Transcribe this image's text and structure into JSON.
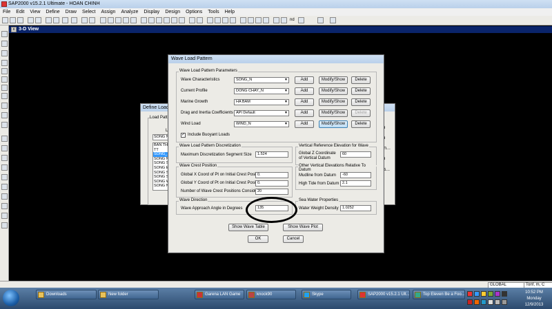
{
  "window": {
    "title": "SAP2000 v15.2.1 Ultimate - HOAN CHINH"
  },
  "menu": [
    "File",
    "Edit",
    "View",
    "Define",
    "Draw",
    "Select",
    "Assign",
    "Analyze",
    "Display",
    "Design",
    "Options",
    "Tools",
    "Help"
  ],
  "toolbar": {
    "nd_label": "nd"
  },
  "view": {
    "tab_label": "3-D View"
  },
  "back_dialog": {
    "title": "Define Load",
    "group_label": "Load Patte",
    "list_label": "Lo",
    "input_value": "SONG N",
    "list_items": [
      "BAN THA",
      "TT",
      "SONG_1",
      "SONG N",
      "SONG S",
      "SONG E",
      "SONG S",
      "SONG S",
      "SONG W",
      "SONG N"
    ],
    "right_buttons": [
      "ern",
      "ern",
      "tern...",
      "ern",
      "ttes..."
    ]
  },
  "dialog": {
    "title": "Wave Load Pattern",
    "params": {
      "legend": "Wave Load Pattern Parameters",
      "rows": [
        {
          "label": "Wave Characteristics",
          "value": "SONG_N",
          "add": "Add",
          "modify": "Modify/Show",
          "delete": "Delete"
        },
        {
          "label": "Current Profile",
          "value": "DONG CHAY_N",
          "add": "Add",
          "modify": "Modify/Show",
          "delete": "Delete"
        },
        {
          "label": "Marine Growth",
          "value": "HA BAM",
          "add": "Add",
          "modify": "Modify/Show",
          "delete": "Delete"
        },
        {
          "label": "Drag and Inertia Coefficients",
          "value": "API Default",
          "add": "Add",
          "modify": "Modify/Show",
          "delete": "Delete"
        },
        {
          "label": "Wind Load",
          "value": "WIND_N",
          "add": "Add",
          "modify": "Modify/Show",
          "delete": "Delete"
        }
      ],
      "buoyant_label": "Include Buoyant Loads"
    },
    "discretization": {
      "legend": "Wave Load Pattern Discretization",
      "label": "Maximum Discretization Segment Size",
      "value": "1.524"
    },
    "vertical_ref": {
      "legend": "Vertical Reference Elevation for Wave",
      "label_line1": "Global Z Coordinate",
      "label_line2": "of Vertical Datum",
      "value": "60"
    },
    "crest": {
      "legend": "Wave Crest Position",
      "rows": [
        {
          "label": "Global X Coord of Pt on Initial Crest Position",
          "value": "0."
        },
        {
          "label": "Global Y Coord of Pt on Initial Crest Position",
          "value": "0."
        },
        {
          "label": "Number of Wave Crest Positions Considered",
          "value": "20"
        }
      ]
    },
    "other_vertical": {
      "legend": "Other Vertical Elevations Relative To Datum",
      "rows": [
        {
          "label": "Mudline from Datum",
          "value": "-60"
        },
        {
          "label": "High Tide from Datum",
          "value": "2.1"
        }
      ]
    },
    "direction": {
      "legend": "Wave Direction",
      "label": "Wave Approach Angle in Degrees",
      "value": "135"
    },
    "seawater": {
      "legend": "Sea Water Properties",
      "label": "Water Weight Density",
      "value": "1.0252"
    },
    "show_table": "Show Wave Table",
    "show_plot": "Show Wave Plot",
    "ok": "OK",
    "cancel": "Cancel"
  },
  "statusbar": {
    "coord": "GLOBAL",
    "units": "Tonf, m, C"
  },
  "taskbar": {
    "items": [
      "Downloads",
      "New folder",
      "Garena LAN Game",
      "knock90",
      "Skype",
      "SAP2000 v15.2.1 Ult...",
      "Top Eleven Be a Foo..."
    ],
    "time": "10:52 PM",
    "day": "Monday",
    "date": "12/9/2013"
  }
}
